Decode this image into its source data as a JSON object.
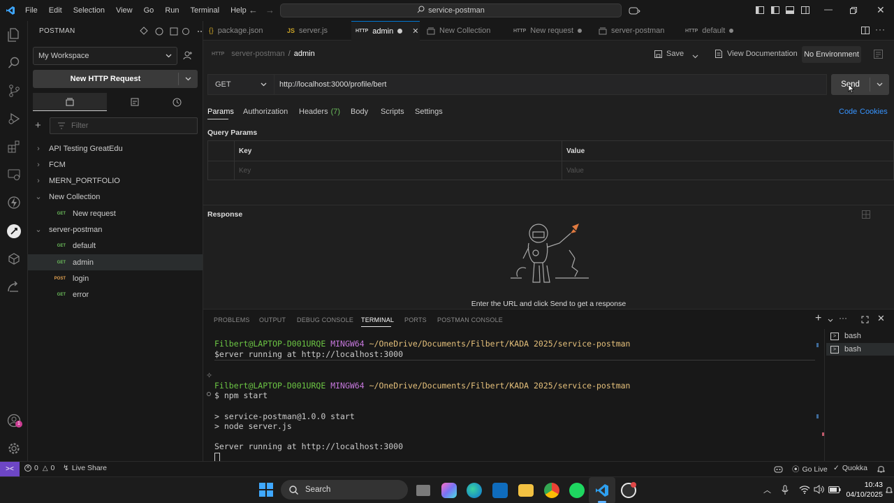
{
  "titlebar": {
    "menu": [
      "File",
      "Edit",
      "Selection",
      "View",
      "Go",
      "Run",
      "Terminal",
      "Help"
    ],
    "search_text": "service-postman"
  },
  "sidebar": {
    "title": "POSTMAN",
    "workspace": "My Workspace",
    "new_request": "New HTTP Request",
    "filter_placeholder": "Filter",
    "tree": [
      {
        "label": "API Testing GreatEdu",
        "type": "folder",
        "expanded": false
      },
      {
        "label": "FCM",
        "type": "folder",
        "expanded": false
      },
      {
        "label": "MERN_PORTFOLIO",
        "type": "folder",
        "expanded": false
      },
      {
        "label": "New Collection",
        "type": "folder",
        "expanded": true
      },
      {
        "label": "New request",
        "type": "request",
        "method": "GET"
      },
      {
        "label": "server-postman",
        "type": "folder",
        "expanded": true
      },
      {
        "label": "default",
        "type": "request",
        "method": "GET"
      },
      {
        "label": "admin",
        "type": "request",
        "method": "GET",
        "selected": true
      },
      {
        "label": "login",
        "type": "request",
        "method": "POST"
      },
      {
        "label": "error",
        "type": "request",
        "method": "GET"
      }
    ]
  },
  "tabs": [
    {
      "label": "package.json",
      "icon": "json-icon"
    },
    {
      "label": "server.js",
      "icon": "js-icon"
    },
    {
      "label": "admin",
      "icon": "http-icon",
      "active": true
    },
    {
      "label": "New Collection",
      "icon": "collection-icon"
    },
    {
      "label": "New request",
      "icon": "http-icon"
    },
    {
      "label": "server-postman",
      "icon": "collection-icon"
    },
    {
      "label": "default",
      "icon": "http-icon"
    }
  ],
  "request": {
    "breadcrumb_parent": "server-postman",
    "breadcrumb_sep": "/",
    "breadcrumb_current": "admin",
    "save": "Save",
    "view_docs": "View Documentation",
    "environment": "No Environment",
    "method": "GET",
    "url": "http://localhost:3000/profile/bert",
    "send": "Send",
    "subtabs": {
      "params": "Params",
      "authorization": "Authorization",
      "headers": "Headers",
      "headers_count": "(7)",
      "body": "Body",
      "scripts": "Scripts",
      "settings": "Settings"
    },
    "code": "Code",
    "cookies": "Cookies",
    "query_params": "Query Params",
    "col_key": "Key",
    "col_value": "Value",
    "key_placeholder": "Key",
    "value_placeholder": "Value"
  },
  "response": {
    "title": "Response",
    "empty_message": "Enter the URL and click Send to get a response"
  },
  "panel": {
    "tabs": [
      "PROBLEMS",
      "OUTPUT",
      "DEBUG CONSOLE",
      "TERMINAL",
      "PORTS",
      "POSTMAN CONSOLE"
    ],
    "active_tab": "TERMINAL",
    "terminals": [
      "bash",
      "bash"
    ],
    "lines": {
      "prompt1_user": "Filbert@LAPTOP-D001URQE",
      "prompt1_shell": "MINGW64",
      "prompt1_path": "~/OneDrive/Documents/Filbert/KADA 2025/service-postman",
      "line2": "$erver running at http://localhost:3000",
      "prompt2_user": "Filbert@LAPTOP-D001URQE",
      "prompt2_shell": "MINGW64",
      "prompt2_path": "~/OneDrive/Documents/Filbert/KADA 2025/service-postman",
      "cmd": "$ npm start",
      "out1": "> service-postman@1.0.0 start",
      "out2": "> node server.js",
      "out3": "Server running at http://localhost:3000"
    }
  },
  "statusbar": {
    "errors": "0",
    "warnings": "0",
    "live_share": "Live Share",
    "go_live": "Go Live",
    "quokka": "Quokka"
  },
  "taskbar": {
    "search": "Search",
    "time": "10:43",
    "date": "04/10/2025"
  },
  "colors": {
    "accent": "#0078d4",
    "get": "#6bbd5b",
    "post": "#e0a050",
    "terminal_green": "#6cc644",
    "terminal_purple": "#c678dd"
  }
}
